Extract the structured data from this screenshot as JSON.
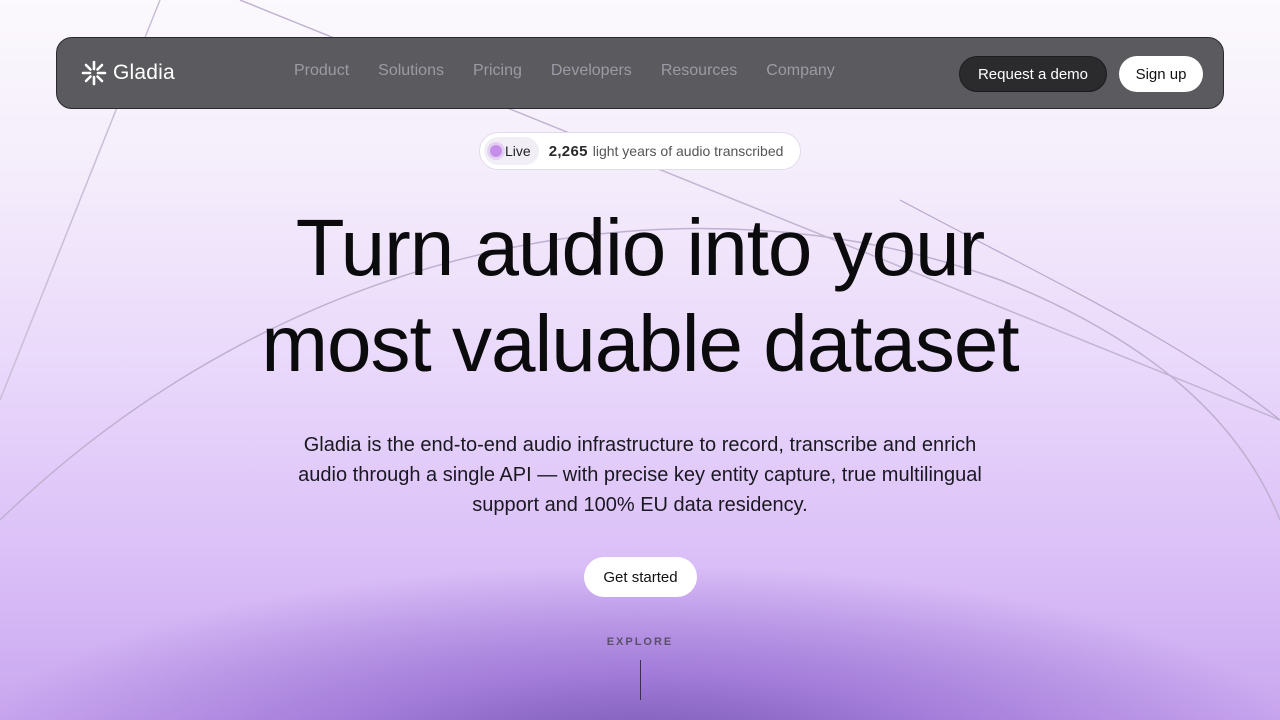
{
  "nav": {
    "brand": "Gladia",
    "logo_icon": "gladia-snowflake-icon",
    "menu": [
      "Product",
      "Solutions",
      "Pricing",
      "Developers",
      "Resources",
      "Company"
    ],
    "demo_label": "Request a demo",
    "signup_label": "Sign up"
  },
  "live": {
    "badge": "Live",
    "count": "2,265",
    "text": "light years of audio transcribed"
  },
  "hero": {
    "title_line1": "Turn audio into your",
    "title_line2": "most valuable dataset",
    "subtitle": "Gladia is the end-to-end audio infrastructure to record, transcribe and enrich audio through a single API — with precise key entity capture, true multilingual support and 100% EU data residency.",
    "cta_label": "Get started",
    "explore_label": "EXPLORE"
  },
  "colors": {
    "nav_bg": "#5b5a5e",
    "accent_purple": "#c58fe9",
    "text_dark": "#0b0b0d"
  }
}
